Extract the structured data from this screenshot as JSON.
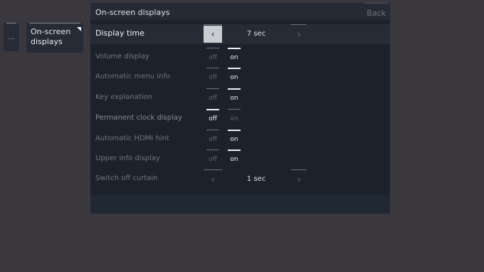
{
  "breadcrumb": {
    "previous_label": "...",
    "current_label_line1": "On-screen",
    "current_label_line2": "displays"
  },
  "panel": {
    "title": "On-screen displays",
    "back_label": "Back"
  },
  "settings": [
    {
      "label": "Display time",
      "type": "stepper",
      "value": "7 sec",
      "prev": "‹",
      "next": "›"
    },
    {
      "label": "Volume display",
      "type": "toggle",
      "off": "off",
      "on": "on",
      "selected": "on"
    },
    {
      "label": "Automatic menu info",
      "type": "toggle",
      "off": "off",
      "on": "on",
      "selected": "on"
    },
    {
      "label": "Key explanation",
      "type": "toggle",
      "off": "off",
      "on": "on",
      "selected": "on"
    },
    {
      "label": "Permanent clock display",
      "type": "toggle",
      "off": "off",
      "on": "on",
      "selected": "off"
    },
    {
      "label": "Automatic HDMI hint",
      "type": "toggle",
      "off": "off",
      "on": "on",
      "selected": "on"
    },
    {
      "label": "Upper info display",
      "type": "toggle",
      "off": "off",
      "on": "on",
      "selected": "on"
    },
    {
      "label": "Switch off curtain",
      "type": "stepper",
      "value": "1 sec",
      "prev": "‹",
      "next": "›"
    }
  ],
  "colors": {
    "background": "#3a383d",
    "panel": "#1b222b",
    "header": "#242b35",
    "focus": "#c9cdd2"
  }
}
